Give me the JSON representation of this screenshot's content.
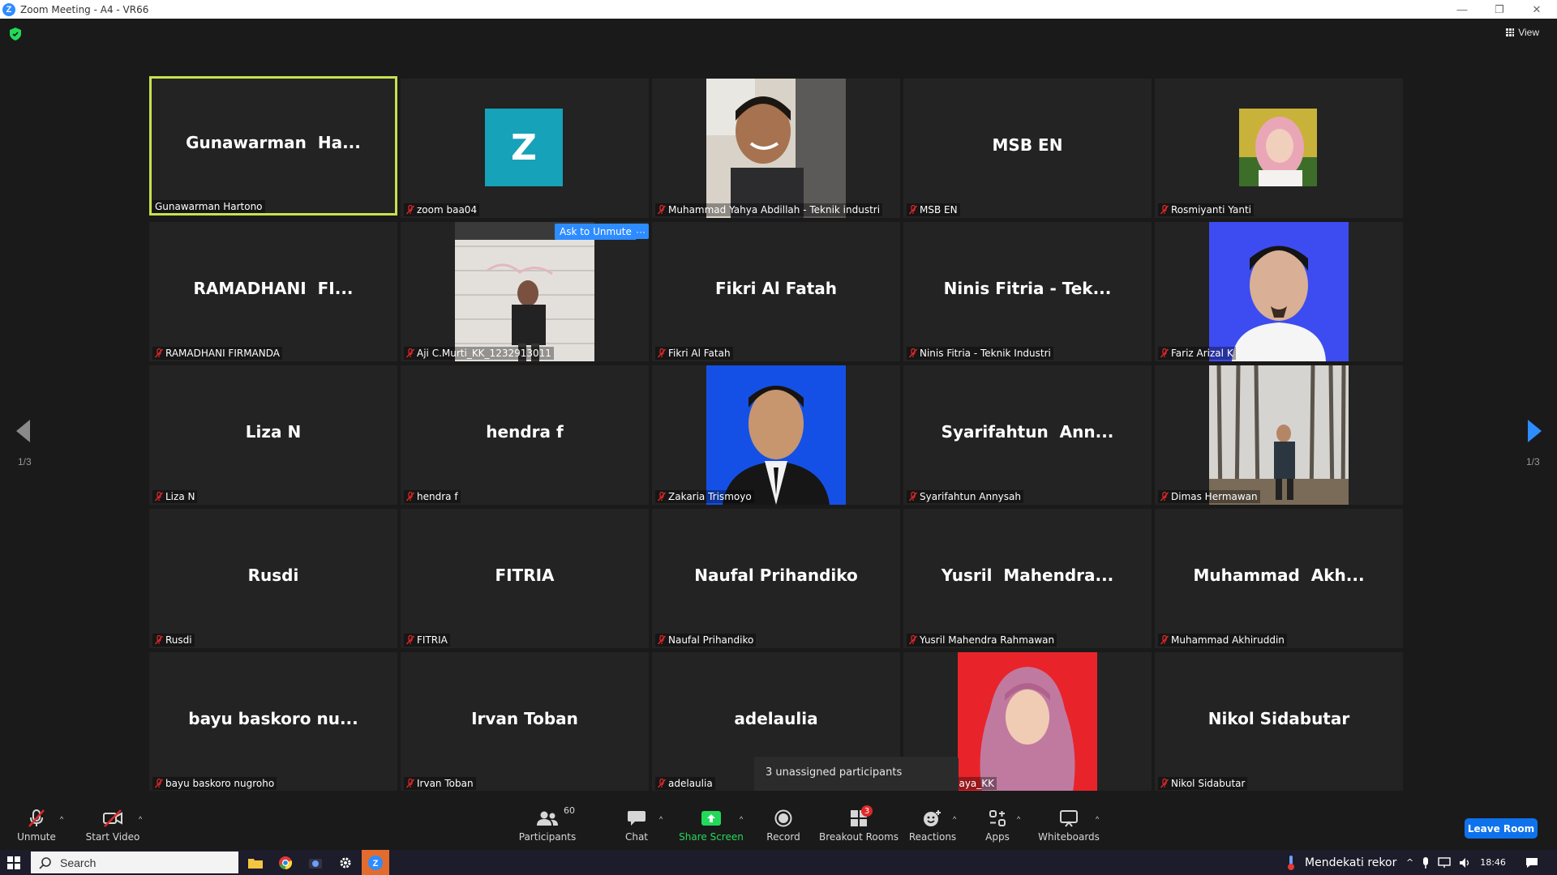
{
  "window": {
    "title": "Zoom Meeting - A4 - VR66"
  },
  "top": {
    "view_label": "View"
  },
  "tiles": [
    {
      "display": "Gunawarman  Ha...",
      "label": "Gunawarman Hartono",
      "muted": false
    },
    {
      "display": "",
      "label": "zoom baa04",
      "muted": true,
      "avatar_letter": "Z"
    },
    {
      "display": "",
      "label": "Muhammad Yahya Abdillah - Teknik industri",
      "muted": true
    },
    {
      "display": "MSB EN",
      "label": "MSB EN",
      "muted": true
    },
    {
      "display": "",
      "label": "Rosmiyanti Yanti",
      "muted": true
    },
    {
      "display": "RAMADHANI  FI...",
      "label": "RAMADHANI FIRMANDA",
      "muted": true
    },
    {
      "display": "",
      "label": "Aji C.Murti_KK_1232913011",
      "muted": true
    },
    {
      "display": "Fikri Al Fatah",
      "label": "Fikri Al Fatah",
      "muted": true
    },
    {
      "display": "Ninis Fitria - Tek...",
      "label": "Ninis Fitria - Teknik Industri",
      "muted": true
    },
    {
      "display": "",
      "label": "Fariz Arizal K",
      "muted": true
    },
    {
      "display": "Liza N",
      "label": "Liza N",
      "muted": true
    },
    {
      "display": "hendra f",
      "label": "hendra f",
      "muted": true
    },
    {
      "display": "",
      "label": "Zakaria Trismoyo",
      "muted": true
    },
    {
      "display": "Syarifahtun  Ann...",
      "label": "Syarifahtun Annysah",
      "muted": true
    },
    {
      "display": "",
      "label": "Dimas Hermawan",
      "muted": true
    },
    {
      "display": "Rusdi",
      "label": "Rusdi",
      "muted": true
    },
    {
      "display": "FITRIA",
      "label": "FITRIA",
      "muted": true
    },
    {
      "display": "Naufal Prihandiko",
      "label": "Naufal Prihandiko",
      "muted": true
    },
    {
      "display": "Yusril  Mahendra...",
      "label": "Yusril Mahendra Rahmawan",
      "muted": true
    },
    {
      "display": "Muhammad  Akh...",
      "label": "Muhammad Akhiruddin",
      "muted": true
    },
    {
      "display": "bayu baskoro nu...",
      "label": "bayu baskoro nugroho",
      "muted": true
    },
    {
      "display": "Irvan Toban",
      "label": "Irvan Toban",
      "muted": true
    },
    {
      "display": "adelaulia",
      "label": "adelaulia",
      "muted": true
    },
    {
      "display": "",
      "label": "illa Fadia Haya_KK",
      "muted": false
    },
    {
      "display": "Nikol Sidabutar",
      "label": "Nikol Sidabutar",
      "muted": true
    }
  ],
  "hover": {
    "ask_to_unmute": "Ask to Unmute",
    "more": "···"
  },
  "pagination": {
    "left": "1/3",
    "right": "1/3"
  },
  "tooltip": "3 unassigned participants",
  "toolbar": {
    "unmute": "Unmute",
    "start_video": "Start Video",
    "participants": "Participants",
    "participants_count": "60",
    "chat": "Chat",
    "share_screen": "Share Screen",
    "record": "Record",
    "breakout_rooms": "Breakout Rooms",
    "breakout_badge": "3",
    "reactions": "Reactions",
    "apps": "Apps",
    "whiteboards": "Whiteboards",
    "leave_room": "Leave Room"
  },
  "taskbar": {
    "search": "Search",
    "weather": "Mendekati rekor",
    "time": "18:46"
  },
  "colors": {
    "active_speaker": "#c7e14f",
    "share_green": "#23d959",
    "accent_blue": "#0e72ed",
    "muted_red": "#e02828"
  }
}
